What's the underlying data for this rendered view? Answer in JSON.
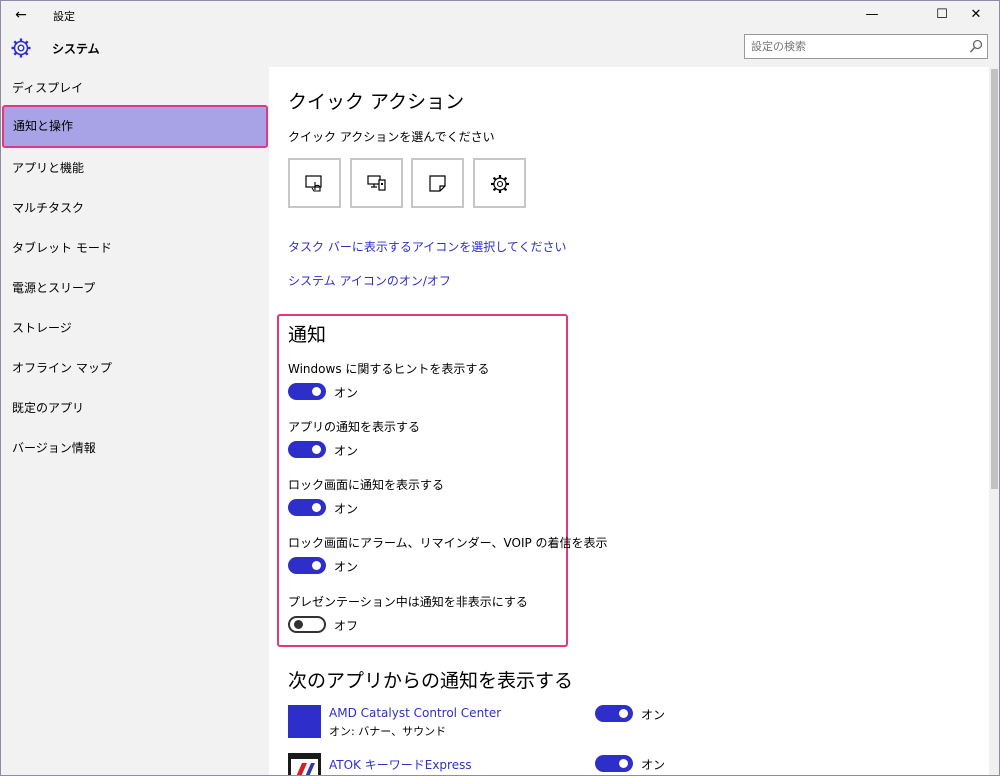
{
  "window": {
    "app_title": "設定",
    "back_glyph": "←",
    "min_glyph": "—",
    "max_glyph": "☐",
    "close_glyph": "✕"
  },
  "header": {
    "section_title": "システム",
    "search_placeholder": "設定の検索"
  },
  "sidebar": {
    "items": [
      {
        "label": "ディスプレイ"
      },
      {
        "label": "通知と操作"
      },
      {
        "label": "アプリと機能"
      },
      {
        "label": "マルチタスク"
      },
      {
        "label": "タブレット モード"
      },
      {
        "label": "電源とスリープ"
      },
      {
        "label": "ストレージ"
      },
      {
        "label": "オフライン マップ"
      },
      {
        "label": "既定のアプリ"
      },
      {
        "label": "バージョン情報"
      }
    ],
    "active_index": 1
  },
  "quick_actions": {
    "title": "クイック アクション",
    "subtitle": "クイック アクションを選んでください",
    "tiles": [
      "tablet-mode-icon",
      "project-icon",
      "note-icon",
      "settings-icon"
    ],
    "link_taskbar": "タスク バーに表示するアイコンを選択してください",
    "link_system_icons": "システム アイコンのオン/オフ"
  },
  "notifications": {
    "title": "通知",
    "settings": [
      {
        "label": "Windows に関するヒントを表示する",
        "state": "on",
        "state_label": "オン"
      },
      {
        "label": "アプリの通知を表示する",
        "state": "on",
        "state_label": "オン"
      },
      {
        "label": "ロック画面に通知を表示する",
        "state": "on",
        "state_label": "オン"
      },
      {
        "label": "ロック画面にアラーム、リマインダー、VOIP の着信を表示",
        "state": "on",
        "state_label": "オン"
      },
      {
        "label": "プレゼンテーション中は通知を非表示にする",
        "state": "off",
        "state_label": "オフ"
      }
    ]
  },
  "apps": {
    "title": "次のアプリからの通知を表示する",
    "items": [
      {
        "name": "AMD Catalyst Control Center",
        "sub": "オン: バナー、サウンド",
        "state_label": "オン"
      },
      {
        "name": "ATOK キーワードExpress",
        "sub": "",
        "state_label": "オン"
      }
    ]
  },
  "colors": {
    "accent": "#2e2ecb",
    "link": "#2f2fc8",
    "highlight": "#e03a7a",
    "sidebar_active": "#a7a3e6",
    "amd_tile": "#2e2ecb"
  }
}
